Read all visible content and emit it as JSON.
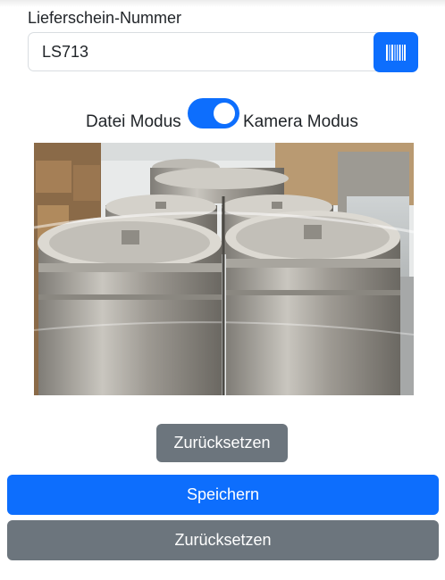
{
  "form": {
    "field_label": "Lieferschein-Nummer",
    "field_value": "LS713",
    "scan_icon": "barcode-icon"
  },
  "mode": {
    "left_label": "Datei Modus",
    "right_label": "Kamera Modus",
    "toggle_on": true
  },
  "image": {
    "description_icon": "keg-photo"
  },
  "buttons": {
    "reset_small": "Zurücksetzen",
    "save": "Speichern",
    "reset_wide": "Zurücksetzen"
  },
  "colors": {
    "primary": "#0d6efd",
    "secondary": "#6c757d"
  }
}
